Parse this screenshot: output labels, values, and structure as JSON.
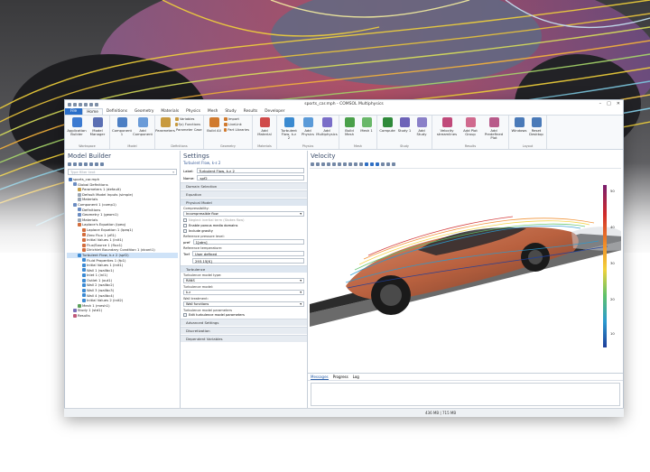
{
  "window": {
    "title": "sports_car.mph - COMSOL Multiphysics",
    "minimize": "–",
    "maximize": "□",
    "close": "✕"
  },
  "ribbon_tabs": [
    "File",
    "Home",
    "Definitions",
    "Geometry",
    "Materials",
    "Physics",
    "Mesh",
    "Study",
    "Results",
    "Developer"
  ],
  "ribbon_groups": [
    {
      "label": "Workspace",
      "items": [
        "Application Builder",
        "Model Manager"
      ]
    },
    {
      "label": "Model",
      "items": [
        "Component 1",
        "Add Component"
      ]
    },
    {
      "label": "Definitions",
      "items": [
        "Parameters"
      ],
      "col": [
        "Variables",
        "f(x) Functions",
        "Parameter Case"
      ]
    },
    {
      "label": "Geometry",
      "items": [
        "Build All"
      ],
      "col": [
        "Import",
        "LiveLink",
        "Part Libraries"
      ]
    },
    {
      "label": "Materials",
      "items": [
        "Add Material"
      ]
    },
    {
      "label": "Physics",
      "items": [
        "Turbulent Flow, k-ε 2",
        "Add Physics",
        "Add Multiphysics"
      ]
    },
    {
      "label": "Mesh",
      "items": [
        "Build Mesh",
        "Mesh 1"
      ]
    },
    {
      "label": "Study",
      "items": [
        "Compute",
        "Study 1",
        "Add Study"
      ]
    },
    {
      "label": "Results",
      "items": [
        "Velocity streamlines",
        "Add Plot Group",
        "Add Predefined Plot"
      ]
    },
    {
      "label": "Layout",
      "items": [
        "Windows",
        "Reset Desktop"
      ]
    }
  ],
  "model_builder": {
    "title": "Model Builder",
    "filter_placeholder": "Type filter text",
    "tree": [
      {
        "label": "sports_car.mph",
        "level": 0,
        "color": "#4a78b8"
      },
      {
        "label": "Global Definitions",
        "level": 1,
        "color": "#6b8cc2"
      },
      {
        "label": "Parameters 1 (default)",
        "level": 2,
        "color": "#c7a04a"
      },
      {
        "label": "Default Model Inputs (simple)",
        "level": 2,
        "color": "#9aa6b5"
      },
      {
        "label": "Materials",
        "level": 2,
        "color": "#9aa6b5"
      },
      {
        "label": "Component 1 (comp1)",
        "level": 1,
        "color": "#6b8cc2"
      },
      {
        "label": "Definitions",
        "level": 2,
        "color": "#6b8cc2"
      },
      {
        "label": "Geometry 1 (geom1)",
        "level": 2,
        "color": "#6b8cc2"
      },
      {
        "label": "Materials",
        "level": 2,
        "color": "#9aa6b5"
      },
      {
        "label": "Laplace's Equation (lpeq)",
        "level": 2,
        "color": "#d36d3c"
      },
      {
        "label": "Laplace Equation 1 (lpeq1)",
        "level": 3,
        "color": "#d36d3c"
      },
      {
        "label": "Zero Flux 1 (zfl1)",
        "level": 3,
        "color": "#d36d3c"
      },
      {
        "label": "Initial Values 1 (init1)",
        "level": 3,
        "color": "#d36d3c"
      },
      {
        "label": "Flux/Source 1 (flux1)",
        "level": 3,
        "color": "#d36d3c"
      },
      {
        "label": "Dirichlet Boundary Condition 1 (dcont1)",
        "level": 3,
        "color": "#d36d3c"
      },
      {
        "label": "Turbulent Flow, k-ε 2 (spf2)",
        "level": 2,
        "color": "#3c8ad3",
        "selected": true
      },
      {
        "label": "Fluid Properties 1 (fp1)",
        "level": 3,
        "color": "#3c8ad3"
      },
      {
        "label": "Initial Values 1 (init1)",
        "level": 3,
        "color": "#3c8ad3"
      },
      {
        "label": "Wall 1 (wallbc1)",
        "level": 3,
        "color": "#3c8ad3"
      },
      {
        "label": "Inlet 1 (inl1)",
        "level": 3,
        "color": "#3c8ad3"
      },
      {
        "label": "Outlet 1 (out1)",
        "level": 3,
        "color": "#3c8ad3"
      },
      {
        "label": "Wall 2 (wallbc2)",
        "level": 3,
        "color": "#3c8ad3"
      },
      {
        "label": "Wall 3 (wallbc3)",
        "level": 3,
        "color": "#3c8ad3"
      },
      {
        "label": "Wall 4 (wallbc4)",
        "level": 3,
        "color": "#3c8ad3"
      },
      {
        "label": "Initial Values 2 (init2)",
        "level": 3,
        "color": "#3c8ad3"
      },
      {
        "label": "Mesh 1 (mesh1)",
        "level": 2,
        "color": "#5aa05a"
      },
      {
        "label": "Study 1 (std1)",
        "level": 1,
        "color": "#7a6fb8"
      },
      {
        "label": "Results",
        "level": 1,
        "color": "#c05a7a"
      }
    ]
  },
  "settings": {
    "title": "Settings",
    "subtitle": "Turbulent Flow, k-ε 2",
    "label_caption": "Label:",
    "label_value": "Turbulent Flow, k-ε 2",
    "name_caption": "Name:",
    "name_value": "spf2",
    "sections": {
      "domain": "Domain Selection",
      "equation": "Equation",
      "physical": "Physical Model",
      "turbulence": "Turbulence",
      "advanced": "Advanced Settings",
      "discretization": "Discretization",
      "dependent": "Dependent Variables"
    },
    "compressibility_caption": "Compressibility:",
    "compressibility_value": "Incompressible flow",
    "opt_neglect": "Neglect inertial term (Stokes flow)",
    "opt_porous": "Enable porous media domains",
    "opt_gravity": "Include gravity",
    "ref_pressure_caption": "Reference pressure level:",
    "ref_pressure_symbol": "pref",
    "ref_pressure_value": "1[atm]",
    "ref_temp_caption": "Reference temperature:",
    "ref_temp_symbol": "Tref",
    "ref_temp_mode": "User defined",
    "ref_temp_value": "293.15[K]",
    "turb_model_type_caption": "Turbulence model type:",
    "turb_model_type_value": "RANS",
    "turb_model_caption": "Turbulence model:",
    "turb_model_value": "k-ε",
    "wall_caption": "Wall treatment:",
    "wall_value": "Wall functions",
    "params_caption": "Turbulence model parameters",
    "edit_params": "Edit turbulence model parameters"
  },
  "graphics": {
    "title": "Velocity",
    "colorbar_labels": [
      "50",
      "40",
      "30",
      "20",
      "10"
    ],
    "colorbar_colors": [
      "#7a1e6e",
      "#d02a2a",
      "#f08a28",
      "#f2d23a",
      "#5ec26a",
      "#2a9ad0",
      "#1f3e9a"
    ]
  },
  "messages": {
    "tabs": [
      "Messages",
      "Progress",
      "Log"
    ]
  },
  "status": {
    "memory": "436 MB | 715 MB"
  }
}
